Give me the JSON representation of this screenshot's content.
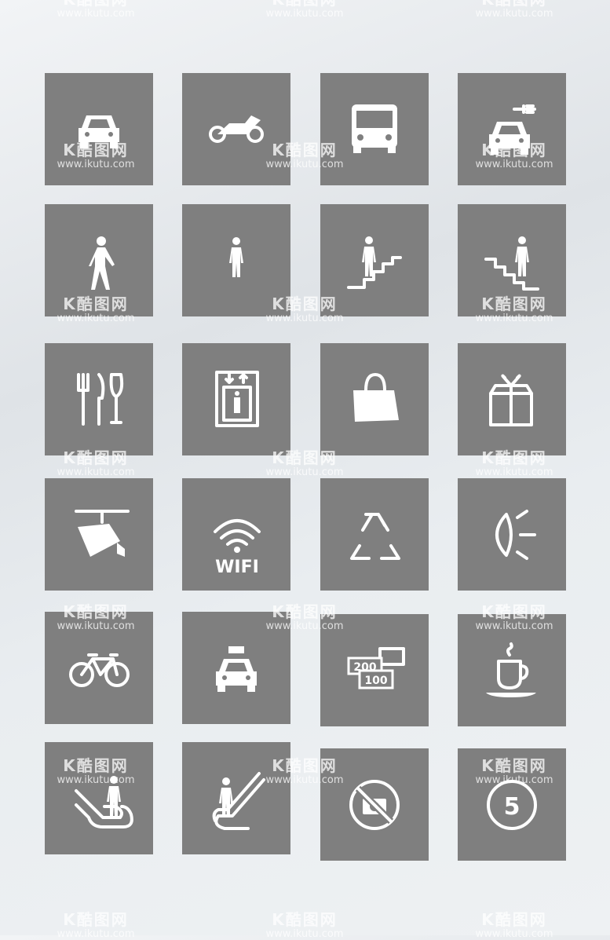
{
  "tile_color": "#7f7f7f",
  "icon_color": "#ffffff",
  "icons": [
    {
      "name": "car-icon"
    },
    {
      "name": "motorcycle-icon"
    },
    {
      "name": "bus-icon"
    },
    {
      "name": "electric-car-icon"
    },
    {
      "name": "pedestrian-icon"
    },
    {
      "name": "pedestrian-front-icon"
    },
    {
      "name": "stairs-up-icon"
    },
    {
      "name": "stairs-down-icon"
    },
    {
      "name": "restaurant-icon"
    },
    {
      "name": "elevator-icon"
    },
    {
      "name": "shopping-bag-icon"
    },
    {
      "name": "gift-icon"
    },
    {
      "name": "surveillance-camera-icon"
    },
    {
      "name": "wifi-icon",
      "label": "WIFI"
    },
    {
      "name": "recycle-icon"
    },
    {
      "name": "headlight-icon"
    },
    {
      "name": "bicycle-icon"
    },
    {
      "name": "taxi-icon"
    },
    {
      "name": "currency-exchange-icon",
      "labels": [
        "200",
        "100"
      ]
    },
    {
      "name": "coffee-icon"
    },
    {
      "name": "escalator-down-icon"
    },
    {
      "name": "escalator-up-icon"
    },
    {
      "name": "no-camera-icon"
    },
    {
      "name": "speed-limit-icon",
      "label": "5"
    }
  ],
  "watermark": {
    "logo": "K酷图网",
    "url": "www.ikutu.com"
  }
}
